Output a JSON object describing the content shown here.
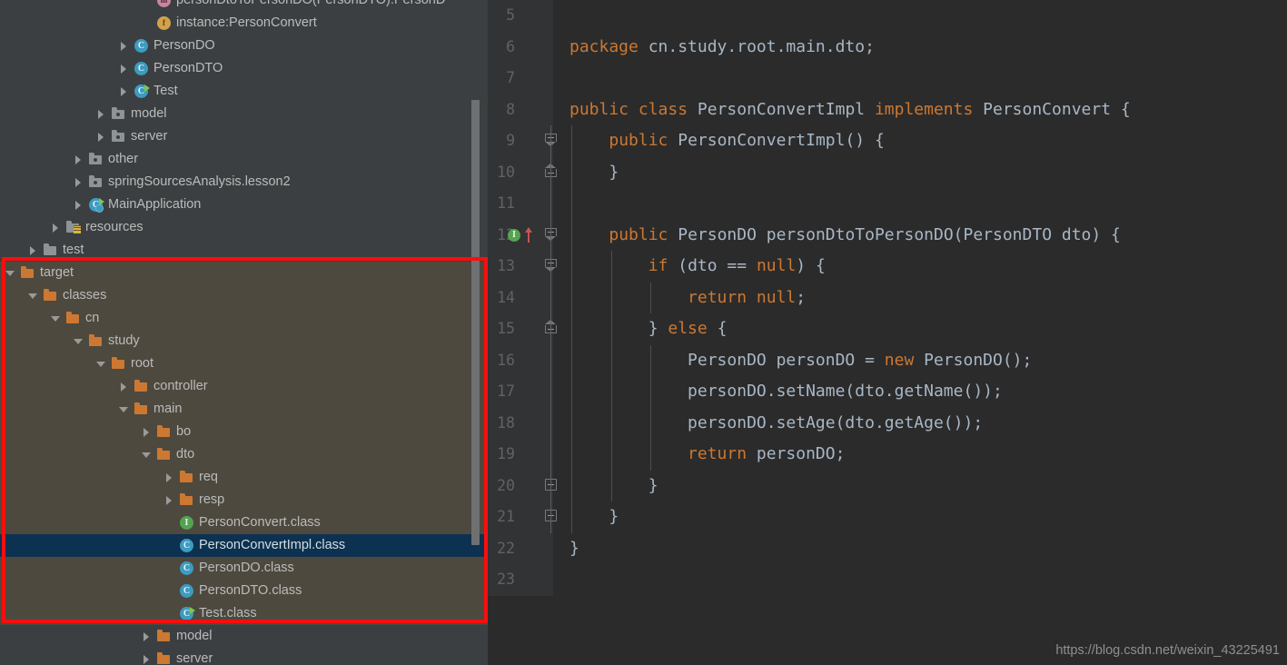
{
  "tree": {
    "panel_name": "project-tool-window",
    "scrollbar": "vertical-scrollbar",
    "items": [
      {
        "label": "personDtoToPersonDO(PersonDTO):PersonD",
        "icon": "method-icon",
        "indent": 6,
        "arrow": "none",
        "clipped": true,
        "kind": "method"
      },
      {
        "label": "instance:PersonConvert",
        "icon": "field-icon",
        "indent": 6,
        "arrow": "none",
        "kind": "field"
      },
      {
        "label": "PersonDO",
        "icon": "class-icon",
        "indent": 5,
        "arrow": "collapsed",
        "kind": "class"
      },
      {
        "label": "PersonDTO",
        "icon": "class-icon",
        "indent": 5,
        "arrow": "collapsed",
        "kind": "class"
      },
      {
        "label": "Test",
        "icon": "class-runnable-icon",
        "indent": 5,
        "arrow": "collapsed",
        "kind": "class-runnable"
      },
      {
        "label": "model",
        "icon": "package-icon",
        "indent": 4,
        "arrow": "collapsed",
        "kind": "package"
      },
      {
        "label": "server",
        "icon": "package-icon",
        "indent": 4,
        "arrow": "collapsed",
        "kind": "package"
      },
      {
        "label": "other",
        "icon": "package-icon",
        "indent": 3,
        "arrow": "collapsed",
        "kind": "package"
      },
      {
        "label": "springSourcesAnalysis.lesson2",
        "icon": "package-icon",
        "indent": 3,
        "arrow": "collapsed",
        "kind": "package"
      },
      {
        "label": "MainApplication",
        "icon": "spring-class-icon",
        "indent": 3,
        "arrow": "collapsed",
        "kind": "spring-class"
      },
      {
        "label": "resources",
        "icon": "resources-folder-icon",
        "indent": 2,
        "arrow": "collapsed",
        "kind": "resources"
      },
      {
        "label": "test",
        "icon": "source-folder-icon",
        "indent": 1,
        "arrow": "collapsed",
        "kind": "source-folder"
      },
      {
        "label": "target",
        "icon": "folder-icon",
        "indent": 0,
        "arrow": "expanded",
        "kind": "folder",
        "highlight": true
      },
      {
        "label": "classes",
        "icon": "folder-icon",
        "indent": 1,
        "arrow": "expanded",
        "kind": "folder",
        "highlight": true
      },
      {
        "label": "cn",
        "icon": "folder-icon",
        "indent": 2,
        "arrow": "expanded",
        "kind": "folder",
        "highlight": true
      },
      {
        "label": "study",
        "icon": "folder-icon",
        "indent": 3,
        "arrow": "expanded",
        "kind": "folder",
        "highlight": true
      },
      {
        "label": "root",
        "icon": "folder-icon",
        "indent": 4,
        "arrow": "expanded",
        "kind": "folder",
        "highlight": true
      },
      {
        "label": "controller",
        "icon": "folder-icon",
        "indent": 5,
        "arrow": "collapsed",
        "kind": "folder",
        "highlight": true
      },
      {
        "label": "main",
        "icon": "folder-icon",
        "indent": 5,
        "arrow": "expanded",
        "kind": "folder",
        "highlight": true
      },
      {
        "label": "bo",
        "icon": "folder-icon",
        "indent": 6,
        "arrow": "collapsed",
        "kind": "folder",
        "highlight": true
      },
      {
        "label": "dto",
        "icon": "folder-icon",
        "indent": 6,
        "arrow": "expanded",
        "kind": "folder",
        "highlight": true
      },
      {
        "label": "req",
        "icon": "folder-icon",
        "indent": 7,
        "arrow": "collapsed",
        "kind": "folder",
        "highlight": true
      },
      {
        "label": "resp",
        "icon": "folder-icon",
        "indent": 7,
        "arrow": "collapsed",
        "kind": "folder",
        "highlight": true
      },
      {
        "label": "PersonConvert.class",
        "icon": "interface-icon",
        "indent": 7,
        "arrow": "none",
        "kind": "interface",
        "highlight": true
      },
      {
        "label": "PersonConvertImpl.class",
        "icon": "class-icon",
        "indent": 7,
        "arrow": "none",
        "kind": "class",
        "highlight": true,
        "selected": true
      },
      {
        "label": "PersonDO.class",
        "icon": "class-icon",
        "indent": 7,
        "arrow": "none",
        "kind": "class",
        "highlight": true
      },
      {
        "label": "PersonDTO.class",
        "icon": "class-icon",
        "indent": 7,
        "arrow": "none",
        "kind": "class",
        "highlight": true
      },
      {
        "label": "Test.class",
        "icon": "class-runnable-icon",
        "indent": 7,
        "arrow": "none",
        "kind": "class-runnable",
        "highlight": true
      },
      {
        "label": "model",
        "icon": "folder-icon",
        "indent": 6,
        "arrow": "collapsed",
        "kind": "folder"
      },
      {
        "label": "server",
        "icon": "folder-icon",
        "indent": 6,
        "arrow": "collapsed",
        "kind": "folder"
      }
    ]
  },
  "editor": {
    "name": "code-editor",
    "lines": [
      {
        "num": "5",
        "fold": "none",
        "tokens": []
      },
      {
        "num": "6",
        "fold": "none",
        "tokens": [
          {
            "t": "package",
            "c": "kw"
          },
          {
            "t": " cn.study.root.main.dto;",
            "c": "id"
          }
        ],
        "indent": 1
      },
      {
        "num": "7",
        "fold": "none",
        "tokens": []
      },
      {
        "num": "8",
        "fold": "none",
        "tokens": [
          {
            "t": "public class",
            "c": "kw"
          },
          {
            "t": " PersonConvertImpl ",
            "c": "id"
          },
          {
            "t": "implements",
            "c": "kw"
          },
          {
            "t": " PersonConvert {",
            "c": "id"
          }
        ],
        "indent": 1
      },
      {
        "num": "9",
        "fold": "open",
        "tokens": [
          {
            "t": "    ",
            "c": "id"
          },
          {
            "t": "public",
            "c": "kw"
          },
          {
            "t": " PersonConvertImpl() {",
            "c": "id"
          }
        ],
        "indent": 2
      },
      {
        "num": "10",
        "fold": "close",
        "tokens": [
          {
            "t": "    }",
            "c": "id"
          }
        ],
        "indent": 2
      },
      {
        "num": "11",
        "fold": "none",
        "tokens": [],
        "indent": 2
      },
      {
        "num": "12",
        "fold": "open",
        "gutter_icons": [
          "implementing-method-icon",
          "overrides-arrow-icon"
        ],
        "tokens": [
          {
            "t": "    ",
            "c": "id"
          },
          {
            "t": "public",
            "c": "kw"
          },
          {
            "t": " PersonDO personDtoToPersonDO(PersonDTO dto) {",
            "c": "id"
          }
        ],
        "indent": 2
      },
      {
        "num": "13",
        "fold": "open",
        "tokens": [
          {
            "t": "        ",
            "c": "id"
          },
          {
            "t": "if",
            "c": "kw"
          },
          {
            "t": " (dto == ",
            "c": "id"
          },
          {
            "t": "null",
            "c": "kw"
          },
          {
            "t": ") {",
            "c": "id"
          }
        ],
        "indent": 3
      },
      {
        "num": "14",
        "fold": "none",
        "tokens": [
          {
            "t": "            ",
            "c": "id"
          },
          {
            "t": "return null",
            "c": "kw"
          },
          {
            "t": ";",
            "c": "id"
          }
        ],
        "indent": 4
      },
      {
        "num": "15",
        "fold": "close",
        "tokens": [
          {
            "t": "        } ",
            "c": "id"
          },
          {
            "t": "else",
            "c": "kw"
          },
          {
            "t": " {",
            "c": "id"
          }
        ],
        "indent": 3
      },
      {
        "num": "16",
        "fold": "none",
        "tokens": [
          {
            "t": "            PersonDO personDO = ",
            "c": "id"
          },
          {
            "t": "new",
            "c": "kw"
          },
          {
            "t": " PersonDO();",
            "c": "id"
          }
        ],
        "indent": 4
      },
      {
        "num": "17",
        "fold": "none",
        "tokens": [
          {
            "t": "            personDO.setName(dto.getName());",
            "c": "id"
          }
        ],
        "indent": 4
      },
      {
        "num": "18",
        "fold": "none",
        "tokens": [
          {
            "t": "            personDO.setAge(dto.getAge());",
            "c": "id"
          }
        ],
        "indent": 4
      },
      {
        "num": "19",
        "fold": "none",
        "tokens": [
          {
            "t": "            ",
            "c": "id"
          },
          {
            "t": "return",
            "c": "kw"
          },
          {
            "t": " personDO;",
            "c": "id"
          }
        ],
        "indent": 4
      },
      {
        "num": "20",
        "fold": "minus",
        "tokens": [
          {
            "t": "        }",
            "c": "id"
          }
        ],
        "indent": 3
      },
      {
        "num": "21",
        "fold": "minus",
        "tokens": [
          {
            "t": "    }",
            "c": "id"
          }
        ],
        "indent": 2
      },
      {
        "num": "22",
        "fold": "none",
        "tokens": [
          {
            "t": "}",
            "c": "id"
          }
        ],
        "indent": 1
      },
      {
        "num": "23",
        "fold": "none",
        "tokens": []
      }
    ]
  },
  "watermark": {
    "text": "https://blog.csdn.net/weixin_43225491"
  },
  "colors": {
    "tree_bg": "#3c3f41",
    "editor_bg": "#2b2b2b",
    "gutter_bg": "#313335",
    "highlight_bg": "#4d493e",
    "selection_bg": "#0d3150",
    "annotation_red": "#fd0d0d",
    "keyword": "#cc7832",
    "identifier": "#a9b7c6",
    "folder_orange": "#cc7832",
    "class_blue": "#3d9bc0",
    "interface_green": "#54a351"
  }
}
